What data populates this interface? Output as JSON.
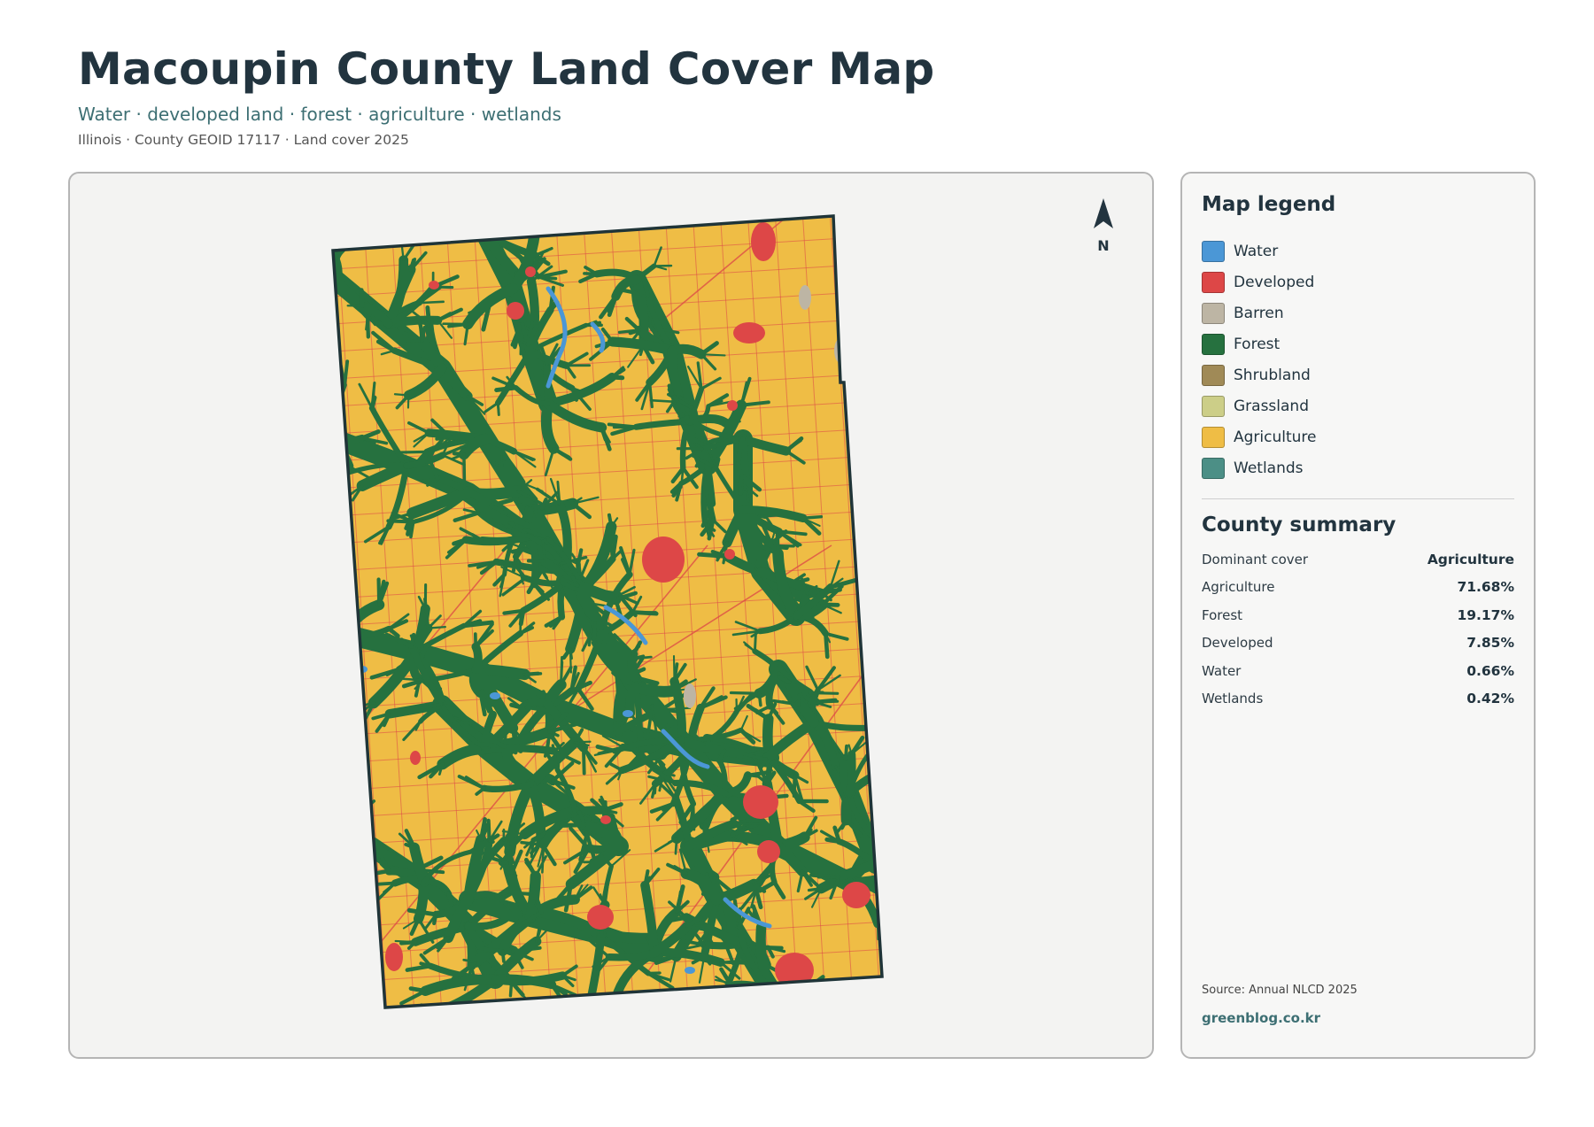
{
  "header": {
    "title": "Macoupin County Land Cover Map",
    "subtitle": "Water · developed land · forest · agriculture · wetlands",
    "meta": "Illinois · County GEOID 17117 · Land cover 2025"
  },
  "map": {
    "north_label": "N",
    "icon": "north-arrow-icon",
    "colors": {
      "water": "#4b97d6",
      "developed": "#dd4747",
      "barren": "#bdb5a4",
      "forest": "#26713f",
      "shrubland": "#a08a57",
      "grassland": "#ccce88",
      "agriculture": "#efbd45",
      "wetlands": "#4c8f86",
      "border": "#1f3438"
    }
  },
  "legend": {
    "title": "Map legend",
    "items": [
      {
        "label": "Water",
        "color": "#4b97d6"
      },
      {
        "label": "Developed",
        "color": "#dd4747"
      },
      {
        "label": "Barren",
        "color": "#bdb5a4"
      },
      {
        "label": "Forest",
        "color": "#26713f"
      },
      {
        "label": "Shrubland",
        "color": "#a08a57"
      },
      {
        "label": "Grassland",
        "color": "#ccce88"
      },
      {
        "label": "Agriculture",
        "color": "#efbd45"
      },
      {
        "label": "Wetlands",
        "color": "#4c8f86"
      }
    ]
  },
  "summary": {
    "title": "County summary",
    "rows": [
      {
        "key": "Dominant cover",
        "value": "Agriculture"
      },
      {
        "key": "Agriculture",
        "value": "71.68%"
      },
      {
        "key": "Forest",
        "value": "19.17%"
      },
      {
        "key": "Developed",
        "value": "7.85%"
      },
      {
        "key": "Water",
        "value": "0.66%"
      },
      {
        "key": "Wetlands",
        "value": "0.42%"
      }
    ]
  },
  "footer": {
    "source": "Source: Annual NLCD 2025",
    "site": "greenblog.co.kr"
  }
}
